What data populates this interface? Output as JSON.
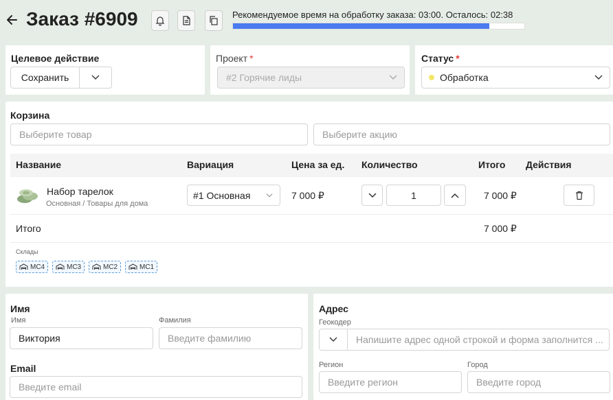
{
  "header": {
    "title": "Заказ #6909",
    "timer_text": "Рекомендуемое время на обработку заказа: 03:00. Осталось: 02:38",
    "progress_fraction": 0.88
  },
  "target": {
    "label": "Целевое действие",
    "save_label": "Сохранить"
  },
  "project": {
    "label": "Проект",
    "required_mark": "*",
    "value": "#2 Горячие лиды"
  },
  "status": {
    "label": "Статус",
    "required_mark": "*",
    "value": "Обработка",
    "dot_color": "#f3e76a"
  },
  "cart": {
    "label": "Корзина",
    "product_placeholder": "Выберите товар",
    "promo_placeholder": "Выберите акцию",
    "columns": {
      "name": "Название",
      "variation": "Вариация",
      "price": "Цена за ед.",
      "qty": "Количество",
      "total": "Итого",
      "actions": "Действия"
    },
    "item": {
      "name": "Набор тарелок",
      "category": "Основная / Товары для дома",
      "variation": "#1 Основная",
      "price": "7 000 ₽",
      "qty": "1",
      "total": "7 000 ₽"
    },
    "summary_label": "Итого",
    "summary_total": "7 000 ₽",
    "warehouses_label": "Склады",
    "warehouses": [
      "МС4",
      "МС3",
      "МС2",
      "МС1"
    ]
  },
  "customer": {
    "name_section": "Имя",
    "first_name_label": "Имя",
    "first_name_value": "Виктория",
    "last_name_label": "Фамилия",
    "last_name_placeholder": "Введите фамилию",
    "email_section": "Email",
    "email_placeholder": "Введите email"
  },
  "address": {
    "label": "Адрес",
    "geocoder_label": "Геокодер",
    "geocoder_placeholder": "Напишите адрес одной строкой и форма заполнится ...",
    "region_label": "Регион",
    "region_placeholder": "Введите регион",
    "city_label": "Город",
    "city_placeholder": "Введите город"
  },
  "colors": {
    "progress": "#4a7bf0",
    "background": "#e6ede6",
    "chip_border": "#5a9ad6"
  }
}
